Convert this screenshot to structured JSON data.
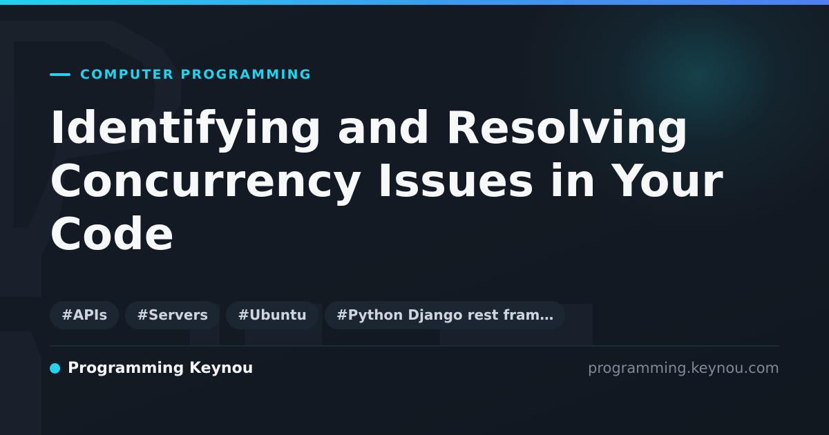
{
  "category": "COMPUTER PROGRAMMING",
  "title": "Identifying and Resolving Concurrency Issues in Your Code",
  "tags": [
    "#APIs",
    "#Servers",
    "#Ubuntu",
    "#Python Django rest fram…"
  ],
  "brand": {
    "name": "Programming Keynou",
    "url": "programming.keynou.com"
  },
  "colors": {
    "accent": "#22d3ee",
    "background": "#131922",
    "title": "#f7f8fa",
    "tag_background": "#1c2632",
    "tag_text": "#cfd5de",
    "url_text": "#7f8894"
  }
}
